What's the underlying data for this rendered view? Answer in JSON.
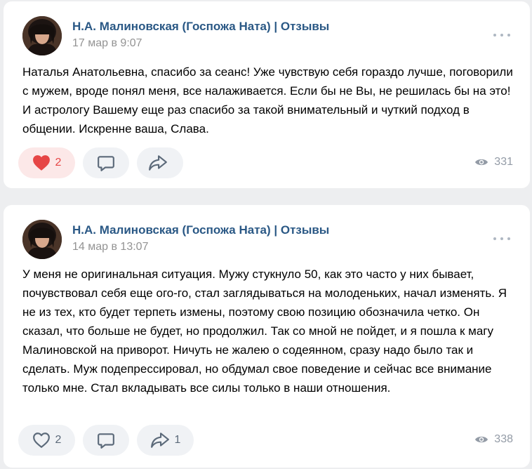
{
  "posts": [
    {
      "author": "Н.А. Малиновская (Госпожа Ната) | Отзывы",
      "date": "17 мар в 9:07",
      "text": "Наталья Анатольевна, спасибо за сеанс! Уже чувствую себя гораздо лучше, поговорили с мужем, вроде понял меня, все налаживается. Если бы не Вы, не решилась бы на это! И астрологу Вашему еще раз спасибо за такой внимательный и чуткий подход в общении. Искренне ваша, Слава.",
      "likes": "2",
      "liked": true,
      "reposts": "",
      "views": "331",
      "icons": {
        "like": "heart-filled-icon",
        "comment": "comment-icon",
        "share": "share-arrow-icon",
        "views": "eye-icon",
        "more": "more-dots-icon"
      }
    },
    {
      "author": "Н.А. Малиновская (Госпожа Ната) | Отзывы",
      "date": "14 мар в 13:07",
      "text": "У меня не оригинальная ситуация. Мужу стукнуло 50, как это часто у них бывает, почувствовал себя еще ого-го, стал заглядываться на молоденьких, начал изменять. Я не из тех, кто будет терпеть измены, поэтому свою позицию обозначила четко. Он сказал, что больше не будет, но продолжил. Так со мной не пойдет, и я пошла к магу Малиновской на приворот. Ничуть не жалею о содеянном, сразу надо было так и сделать. Муж подепрессировал, но обдумал свое поведение и сейчас все внимание только мне. Стал вкладывать все силы только в наши отношения.",
      "likes": "2",
      "liked": false,
      "reposts": "1",
      "views": "338",
      "icons": {
        "like": "heart-outline-icon",
        "comment": "comment-icon",
        "share": "share-arrow-icon",
        "views": "eye-icon",
        "more": "more-dots-icon"
      }
    }
  ],
  "colors": {
    "page_bg": "#edeef0",
    "card_bg": "#ffffff",
    "author": "#2a5885",
    "meta": "#939393",
    "like_active": "#e64646",
    "icon": "#5c6a7a"
  }
}
